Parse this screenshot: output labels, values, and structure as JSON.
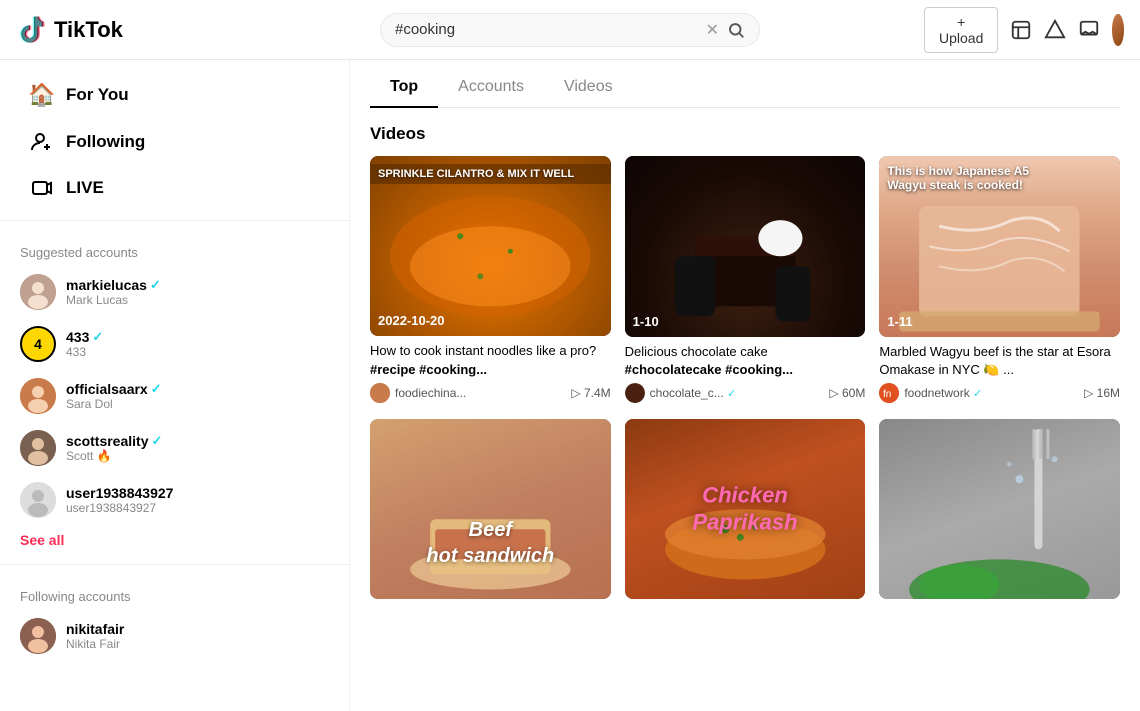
{
  "header": {
    "logo_text": "TikTok",
    "search_value": "#cooking",
    "upload_label": "+ Upload"
  },
  "sidebar": {
    "nav_items": [
      {
        "id": "for-you",
        "label": "For You",
        "icon": "🏠"
      },
      {
        "id": "following",
        "label": "Following",
        "icon": "👤"
      },
      {
        "id": "live",
        "label": "LIVE",
        "icon": "📹"
      }
    ],
    "suggested_title": "Suggested accounts",
    "suggested_accounts": [
      {
        "name": "markielucas",
        "handle": "Mark Lucas",
        "verified": true,
        "color": "#888"
      },
      {
        "name": "433",
        "handle": "433",
        "verified": true,
        "type": "yellow"
      },
      {
        "name": "officialsaarx",
        "handle": "Sara Dol",
        "verified": true,
        "color": "#c97b4b"
      },
      {
        "name": "scottsreality",
        "handle": "Scott 🔥",
        "verified": true,
        "color": "#7a6050"
      },
      {
        "name": "user1938843927",
        "handle": "user1938843927",
        "verified": false,
        "color": "#ccc",
        "icon": true
      }
    ],
    "see_all_label": "See all",
    "following_title": "Following accounts",
    "following_accounts": [
      {
        "name": "nikitafair",
        "handle": "Nikita Fair",
        "color": "#8b6050"
      }
    ]
  },
  "search_tabs": [
    {
      "id": "top",
      "label": "Top",
      "active": true
    },
    {
      "id": "accounts",
      "label": "Accounts",
      "active": false
    },
    {
      "id": "videos",
      "label": "Videos",
      "active": false
    }
  ],
  "videos_section": {
    "heading": "Videos",
    "videos": [
      {
        "id": "v1",
        "bg_class": "bg-noodles",
        "overlay_text": "SPRINKLE CILANTRO & MIX IT WELL",
        "date_label": "2022-10-20",
        "title": "How to cook instant noodles like a pro? ",
        "hashtags": "#recipe #cooking...",
        "author": "foodiechina...",
        "author_verified": false,
        "play_count": "7.4M",
        "art": "noodle"
      },
      {
        "id": "v2",
        "bg_class": "bg-cake",
        "overlay_text": "",
        "date_label": "1-10",
        "title": "Delicious chocolate cake ",
        "hashtags": "#chocolatecake #cooking...",
        "author": "chocolate_c...",
        "author_verified": true,
        "play_count": "60M",
        "art": "cake"
      },
      {
        "id": "v3",
        "bg_class": "bg-wagyu",
        "overlay_text": "This is how Japanese A5 Wagyu steak is cooked!",
        "date_label": "1-11",
        "title": "Marbled Wagyu beef is the star at Esora Omakase in NYC 🍋 ...",
        "hashtags": "",
        "author": "foodnetwork",
        "author_verified": true,
        "play_count": "16M",
        "art": "wagyu"
      },
      {
        "id": "v4",
        "bg_class": "bg-beef",
        "overlay_text": "",
        "date_label": "",
        "title": "Beef hot sandwich",
        "hashtags": "",
        "author": "",
        "author_verified": false,
        "play_count": "",
        "art": "beef"
      },
      {
        "id": "v5",
        "bg_class": "bg-chicken",
        "overlay_text": "",
        "date_label": "",
        "title": "Chicken Paprikash",
        "hashtags": "",
        "author": "",
        "author_verified": false,
        "play_count": "",
        "art": "chicken"
      },
      {
        "id": "v6",
        "bg_class": "bg-fork",
        "overlay_text": "",
        "date_label": "",
        "title": "",
        "hashtags": "",
        "author": "",
        "author_verified": false,
        "play_count": "",
        "art": "fork"
      }
    ]
  }
}
